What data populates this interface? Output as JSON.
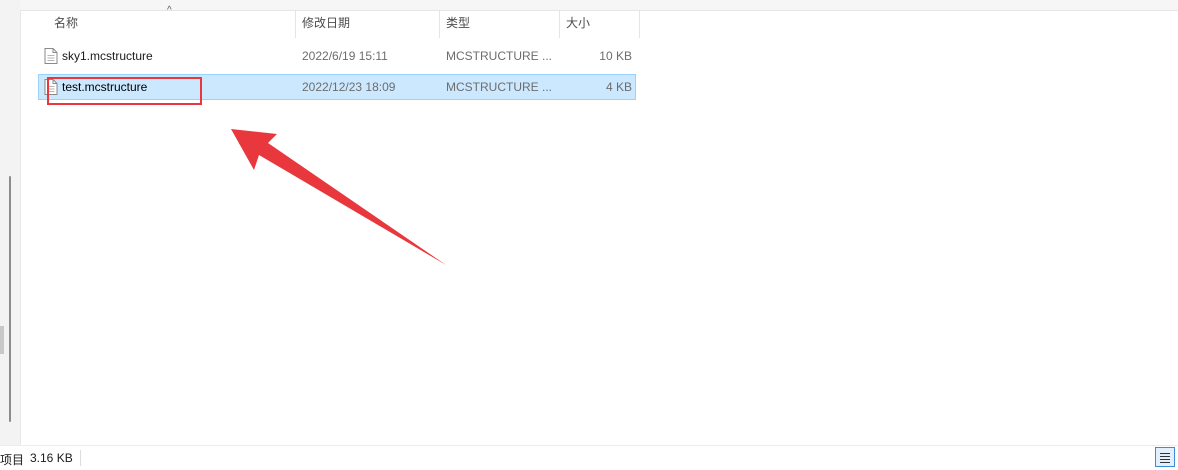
{
  "columns": {
    "name": "名称",
    "modified": "修改日期",
    "type": "类型",
    "size": "大小"
  },
  "files": [
    {
      "name": "sky1.mcstructure",
      "modified": "2022/6/19 15:11",
      "type": "MCSTRUCTURE ...",
      "size": "10 KB",
      "selected": false
    },
    {
      "name": "test.mcstructure",
      "modified": "2022/12/23 18:09",
      "type": "MCSTRUCTURE ...",
      "size": "4 KB",
      "selected": true
    }
  ],
  "status": {
    "items_fragment": "项目",
    "selected_size": "3.16 KB"
  },
  "annotation": {
    "highlight_color": "#e8383d",
    "arrow_color": "#e8383d"
  },
  "colors": {
    "selection_bg": "#cce8ff",
    "selection_border": "#99d1ff"
  },
  "icons": {
    "sort": "sort-up-icon",
    "file": "file-icon",
    "view": "details-view-icon"
  }
}
